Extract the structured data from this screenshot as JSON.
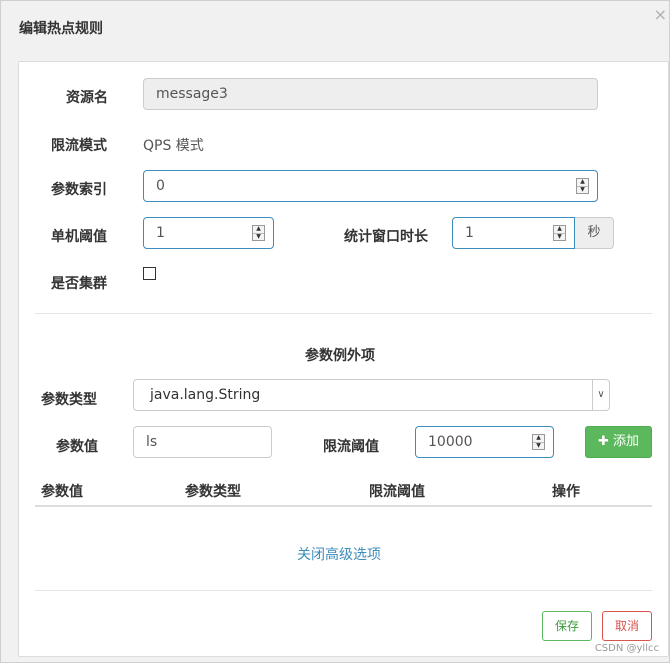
{
  "dialog": {
    "title": "编辑热点规则",
    "close_symbol": "×"
  },
  "form": {
    "resource_label": "资源名",
    "resource_value": "message3",
    "mode_label": "限流模式",
    "mode_value": "QPS 模式",
    "param_index_label": "参数索引",
    "param_index_value": "0",
    "threshold_label": "单机阈值",
    "threshold_value": "1",
    "window_label": "统计窗口时长",
    "window_value": "1",
    "window_unit": "秒",
    "cluster_label": "是否集群",
    "cluster_checked": false
  },
  "exceptions": {
    "section_title": "参数例外项",
    "type_label": "参数类型",
    "type_selected": "java.lang.String",
    "value_label": "参数值",
    "value_input": "ls",
    "limit_label": "限流阈值",
    "limit_input": "10000",
    "add_button": "添加",
    "add_icon": "plus-icon"
  },
  "table": {
    "headers": [
      "参数值",
      "参数类型",
      "限流阈值",
      "操作"
    ]
  },
  "advanced_link": "关闭高级选项",
  "footer": {
    "save": "保存",
    "cancel": "取消"
  },
  "watermark": "CSDN @yllcc",
  "colors": {
    "accent": "#3c8dbc",
    "success": "#5cb85c",
    "danger": "#d9534f"
  }
}
